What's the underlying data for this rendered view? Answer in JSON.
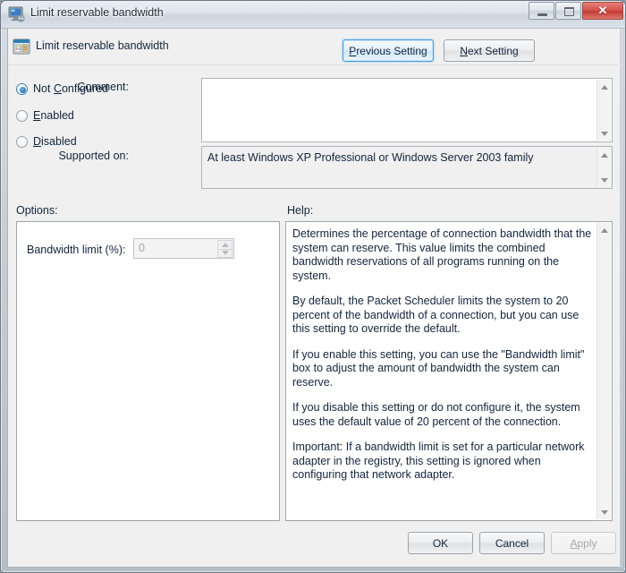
{
  "window": {
    "title": "Limit reservable bandwidth",
    "icon": "computer-monitor-icon",
    "controls": {
      "minimize": "Minimize",
      "maximize": "Restore",
      "close": "✕"
    }
  },
  "header": {
    "icon": "policy-setting-icon",
    "title": "Limit reservable bandwidth",
    "previous_button": {
      "label": "Previous Setting",
      "accel": "P",
      "rest": "revious Setting"
    },
    "next_button": {
      "label": "Next Setting",
      "accel": "N",
      "rest": "ext Setting"
    }
  },
  "state": {
    "options": [
      {
        "id": "not-configured",
        "pre": "Not ",
        "accel": "C",
        "post": "onfigured",
        "selected": true
      },
      {
        "id": "enabled",
        "pre": "",
        "accel": "E",
        "post": "nabled",
        "selected": false
      },
      {
        "id": "disabled",
        "pre": "",
        "accel": "D",
        "post": "isabled",
        "selected": false
      }
    ]
  },
  "comment": {
    "label": "Comment:",
    "value": "",
    "placeholder": ""
  },
  "supported": {
    "label": "Supported on:",
    "value": "At least Windows XP Professional or Windows Server 2003 family"
  },
  "options_panel": {
    "caption": "Options:",
    "bandwidth_label": "Bandwidth limit (%):",
    "bandwidth_value": "0",
    "bandwidth_enabled": false
  },
  "help_panel": {
    "caption": "Help:",
    "paragraphs": [
      "Determines the percentage of connection bandwidth that the system can reserve. This value limits the combined bandwidth reservations of all programs running on the system.",
      "By default, the Packet Scheduler limits the system to 20 percent of the bandwidth of a connection, but you can use this setting to override the default.",
      "If you enable this setting, you can use the \"Bandwidth limit\" box to adjust the amount of bandwidth the system can reserve.",
      "If you disable this setting or do not configure it, the system uses the default value of 20 percent of the connection.",
      "Important: If a bandwidth limit is set for a particular network adapter in the registry, this setting is ignored when configuring that network adapter."
    ]
  },
  "footer": {
    "ok": "OK",
    "cancel": "Cancel",
    "apply": {
      "accel": "A",
      "rest": "pply",
      "enabled": false
    }
  },
  "colors": {
    "accent_focus": "#4a9ee0",
    "close_red": "#c13c34",
    "radio_blue": "#2a72ad",
    "text": "#13253c",
    "disabled_text": "#a6a6a6"
  }
}
